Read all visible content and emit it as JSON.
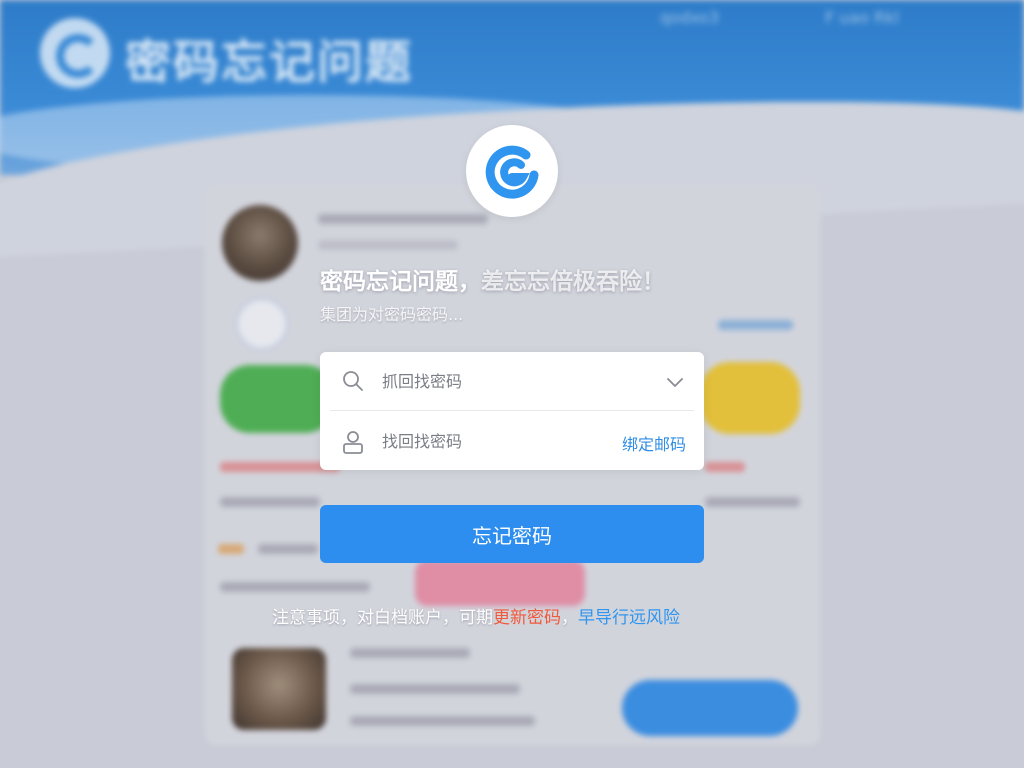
{
  "background": {
    "page_title": "密码忘记问题",
    "top_right_left": "qodxo3",
    "top_right_right": "F uao Rkl"
  },
  "headline": {
    "main": "密码忘记问题，",
    "ghost": "差忘忘倍极吞险！"
  },
  "subtitle": "集团为对密码密码...",
  "form": {
    "field1_placeholder": "抓回找密码",
    "field2_placeholder": "找回找密码",
    "bind_email_link": "绑定邮码"
  },
  "submit_label": "忘记密码",
  "notice": {
    "prefix": "注意事项，对白档账户，可期",
    "highlight_red": "更新密码",
    "comma": "，",
    "highlight_blue": "早导行远风险"
  },
  "colors": {
    "header_blue": "#2e7cc9",
    "primary_button": "#2d8ef0",
    "link_blue": "#2f8de4",
    "accent_red": "#f05a3c",
    "logo_blue": "#2f95ef"
  },
  "icons": {
    "logo": "brand-swirl-icon",
    "field1": "search-icon",
    "field1_trailing": "chevron-down-icon",
    "field2": "user-icon"
  }
}
